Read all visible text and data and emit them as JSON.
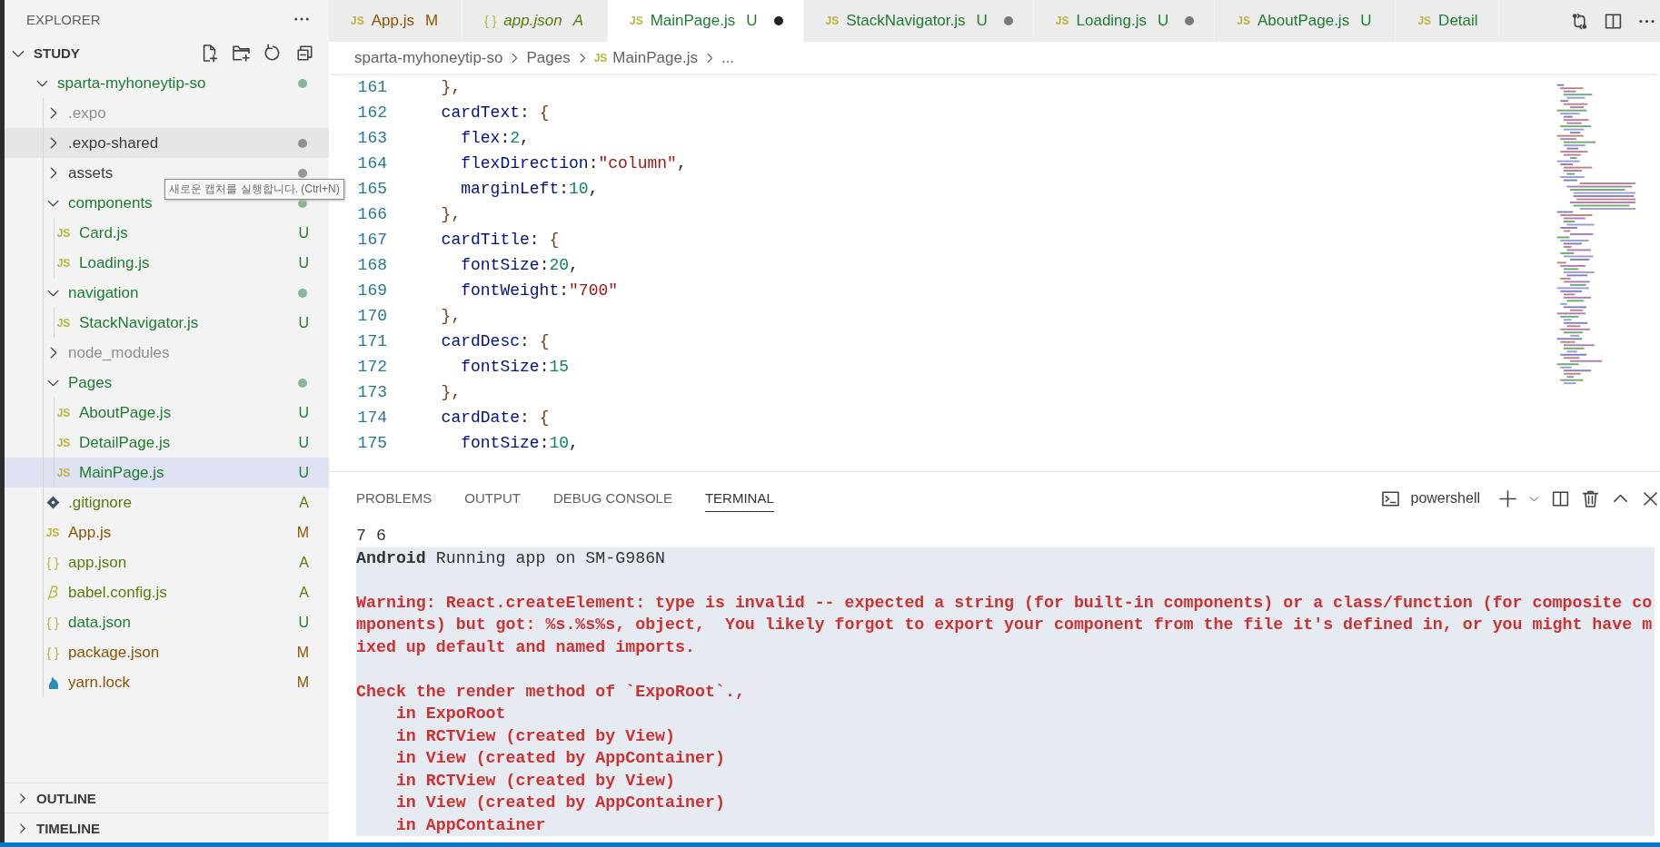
{
  "sidebar": {
    "title": "EXPLORER",
    "workspace": {
      "title": "STUDY",
      "expanded": true,
      "tree": [
        {
          "label": "sparta-myhoneytip-so",
          "kind": "folder",
          "color": "#1e7b34",
          "dot": true,
          "expanded": true,
          "selected": false,
          "children": [
            {
              "label": ".expo",
              "kind": "folder",
              "color": "#8e8e90",
              "dot": false,
              "expanded": false,
              "selected": false
            },
            {
              "label": ".expo-shared",
              "kind": "folder",
              "color": "#3b3b3b",
              "dot": true,
              "expanded": false,
              "selected": false,
              "hovered": true
            },
            {
              "label": "assets",
              "kind": "folder",
              "color": "#3b3b3b",
              "dot": true,
              "expanded": false,
              "selected": false
            },
            {
              "label": "components",
              "kind": "folder",
              "color": "#1e7b34",
              "dot": true,
              "expanded": true,
              "selected": false,
              "children": [
                {
                  "label": "Card.js",
                  "kind": "js",
                  "glyph": "JS",
                  "color": "#1e7b34",
                  "badge": "U",
                  "selected": false
                },
                {
                  "label": "Loading.js",
                  "kind": "js",
                  "glyph": "JS",
                  "color": "#1e7b34",
                  "badge": "U",
                  "selected": false
                }
              ]
            },
            {
              "label": "navigation",
              "kind": "folder",
              "color": "#1e7b34",
              "dot": true,
              "expanded": true,
              "selected": false,
              "children": [
                {
                  "label": "StackNavigator.js",
                  "kind": "js",
                  "glyph": "JS",
                  "color": "#1e7b34",
                  "badge": "U",
                  "selected": false
                }
              ]
            },
            {
              "label": "node_modules",
              "kind": "folder",
              "color": "#8e8e90",
              "dot": false,
              "expanded": false,
              "selected": false
            },
            {
              "label": "Pages",
              "kind": "folder",
              "color": "#1e7b34",
              "dot": true,
              "expanded": true,
              "selected": false,
              "children": [
                {
                  "label": "AboutPage.js",
                  "kind": "js",
                  "glyph": "JS",
                  "color": "#1e7b34",
                  "badge": "U",
                  "selected": false
                },
                {
                  "label": "DetailPage.js",
                  "kind": "js",
                  "glyph": "JS",
                  "color": "#1e7b34",
                  "badge": "U",
                  "selected": false
                },
                {
                  "label": "MainPage.js",
                  "kind": "js",
                  "glyph": "JS",
                  "color": "#1e7b34",
                  "badge": "U",
                  "selected": true
                }
              ]
            },
            {
              "label": ".gitignore",
              "kind": "git",
              "color": "#587c0c",
              "badge": "A",
              "selected": false
            },
            {
              "label": "App.js",
              "kind": "js",
              "glyph": "JS",
              "color": "#895503",
              "badge": "M",
              "selected": false
            },
            {
              "label": "app.json",
              "kind": "json",
              "glyph": "{ }",
              "color": "#587c0c",
              "badge": "A",
              "selected": false
            },
            {
              "label": "babel.config.js",
              "kind": "babel",
              "color": "#587c0c",
              "badge": "A",
              "selected": false
            },
            {
              "label": "data.json",
              "kind": "json",
              "glyph": "{ }",
              "color": "#1e7b34",
              "badge": "U",
              "selected": false
            },
            {
              "label": "package.json",
              "kind": "json",
              "glyph": "{ }",
              "color": "#895503",
              "badge": "M",
              "selected": false
            },
            {
              "label": "yarn.lock",
              "kind": "yarn",
              "color": "#895503",
              "badge": "M",
              "selected": false
            }
          ]
        }
      ]
    },
    "sections": [
      {
        "title": "OUTLINE",
        "expanded": false
      },
      {
        "title": "TIMELINE",
        "expanded": false
      }
    ]
  },
  "tabs": [
    {
      "label": "App.js",
      "glyph": "JS",
      "color": "#895503",
      "status": "M",
      "italic": false,
      "dirty": false,
      "selected": false
    },
    {
      "label": "app.json",
      "glyph": "{ }",
      "color": "#587c0c",
      "status": "A",
      "italic": true,
      "dirty": false,
      "selected": false
    },
    {
      "label": "MainPage.js",
      "glyph": "JS",
      "color": "#1e7b34",
      "status": "U",
      "italic": false,
      "dirty": true,
      "selected": true
    },
    {
      "label": "StackNavigator.js",
      "glyph": "JS",
      "color": "#1e7b34",
      "status": "U",
      "italic": false,
      "dirty": true,
      "selected": false
    },
    {
      "label": "Loading.js",
      "glyph": "JS",
      "color": "#1e7b34",
      "status": "U",
      "italic": false,
      "dirty": true,
      "selected": false
    },
    {
      "label": "AboutPage.js",
      "glyph": "JS",
      "color": "#1e7b34",
      "status": "U",
      "italic": false,
      "dirty": false,
      "selected": false
    },
    {
      "label": "Detail",
      "glyph": "JS",
      "color": "#1e7b34",
      "italic": false,
      "dirty": false,
      "selected": false
    }
  ],
  "breadcrumb": [
    {
      "label": "sparta-myhoneytip-so"
    },
    {
      "label": "Pages"
    },
    {
      "label": "MainPage.js",
      "glyph": "JS"
    },
    {
      "label": "..."
    }
  ],
  "code": [
    {
      "number": "161",
      "tokens": [
        {
          "text": "  },",
          "kind": "brace"
        }
      ]
    },
    {
      "number": "162",
      "tokens": [
        {
          "text": "  cardText",
          "kind": "key"
        },
        {
          "text": ": ",
          "kind": "punct"
        },
        {
          "text": "{",
          "kind": "brace"
        }
      ]
    },
    {
      "number": "163",
      "tokens": [
        {
          "text": "    flex",
          "kind": "key"
        },
        {
          "text": ":",
          "kind": "punct"
        },
        {
          "text": "2",
          "kind": "num"
        },
        {
          "text": ",",
          "kind": "punct"
        }
      ]
    },
    {
      "number": "164",
      "tokens": [
        {
          "text": "    flexDirection",
          "kind": "key"
        },
        {
          "text": ":",
          "kind": "punct"
        },
        {
          "text": "\"column\"",
          "kind": "str"
        },
        {
          "text": ",",
          "kind": "punct"
        }
      ]
    },
    {
      "number": "165",
      "tokens": [
        {
          "text": "    marginLeft",
          "kind": "key"
        },
        {
          "text": ":",
          "kind": "punct"
        },
        {
          "text": "10",
          "kind": "num"
        },
        {
          "text": ",",
          "kind": "punct"
        }
      ]
    },
    {
      "number": "166",
      "tokens": [
        {
          "text": "  },",
          "kind": "brace"
        }
      ]
    },
    {
      "number": "167",
      "tokens": [
        {
          "text": "  cardTitle",
          "kind": "key"
        },
        {
          "text": ": ",
          "kind": "punct"
        },
        {
          "text": "{",
          "kind": "brace"
        }
      ]
    },
    {
      "number": "168",
      "tokens": [
        {
          "text": "    fontSize",
          "kind": "key"
        },
        {
          "text": ":",
          "kind": "punct"
        },
        {
          "text": "20",
          "kind": "num"
        },
        {
          "text": ",",
          "kind": "punct"
        }
      ]
    },
    {
      "number": "169",
      "tokens": [
        {
          "text": "    fontWeight",
          "kind": "key"
        },
        {
          "text": ":",
          "kind": "punct"
        },
        {
          "text": "\"700\"",
          "kind": "str"
        }
      ]
    },
    {
      "number": "170",
      "tokens": [
        {
          "text": "  },",
          "kind": "brace"
        }
      ]
    },
    {
      "number": "171",
      "tokens": [
        {
          "text": "  cardDesc",
          "kind": "key"
        },
        {
          "text": ": ",
          "kind": "punct"
        },
        {
          "text": "{",
          "kind": "brace"
        }
      ]
    },
    {
      "number": "172",
      "tokens": [
        {
          "text": "    fontSize",
          "kind": "key"
        },
        {
          "text": ":",
          "kind": "punct"
        },
        {
          "text": "15",
          "kind": "num"
        }
      ]
    },
    {
      "number": "173",
      "tokens": [
        {
          "text": "  },",
          "kind": "brace"
        }
      ]
    },
    {
      "number": "174",
      "tokens": [
        {
          "text": "  cardDate",
          "kind": "key"
        },
        {
          "text": ": ",
          "kind": "punct"
        },
        {
          "text": "{",
          "kind": "brace"
        }
      ]
    },
    {
      "number": "175",
      "tokens": [
        {
          "text": "    fontSize",
          "kind": "key"
        },
        {
          "text": ":",
          "kind": "punct"
        },
        {
          "text": "10",
          "kind": "num"
        },
        {
          "text": ",",
          "kind": "punct"
        }
      ]
    }
  ],
  "panel": {
    "tabs": [
      {
        "label": "PROBLEMS",
        "selected": false
      },
      {
        "label": "OUTPUT",
        "selected": false
      },
      {
        "label": "DEBUG CONSOLE",
        "selected": false
      },
      {
        "label": "TERMINAL",
        "selected": true
      }
    ],
    "shell": "powershell",
    "terminal": [
      [
        {
          "text": "7 6",
          "kind": "plain",
          "selected": false
        },
        {
          "text": "**Android** Running app on SM-G986N",
          "kind": "plain",
          "selected": true
        }
      ],
      [
        {
          "text": "Warning: React.createElement: type is invalid -- expected a string (for built-in components) or a class/function (for composite co",
          "kind": "error",
          "selected": true
        },
        {
          "text": "mponents) but got: %s.%s%s, object,  You likely forgot to export your component from the file it's defined in, or you might have m",
          "kind": "error",
          "selected": true
        },
        {
          "text": "ixed up default and named imports.",
          "kind": "error",
          "selected": true
        }
      ],
      [
        {
          "text": "Check the render method of `ExpoRoot`.,",
          "kind": "error",
          "selected": true
        },
        {
          "text": "    in ExpoRoot",
          "kind": "error",
          "selected": true
        },
        {
          "text": "    in RCTView (created by View)",
          "kind": "error",
          "selected": true
        },
        {
          "text": "    in View (created by AppContainer)",
          "kind": "error",
          "selected": true
        },
        {
          "text": "    in RCTView (created by View)",
          "kind": "error",
          "selected": true
        },
        {
          "text": "    in View (created by AppContainer)",
          "kind": "error",
          "selected": true
        },
        {
          "text": "    in AppContainer",
          "kind": "error",
          "selected": true
        }
      ]
    ]
  },
  "tooltip": {
    "text": "새로운 캡처를 실행합니다. (Ctrl+N)"
  }
}
